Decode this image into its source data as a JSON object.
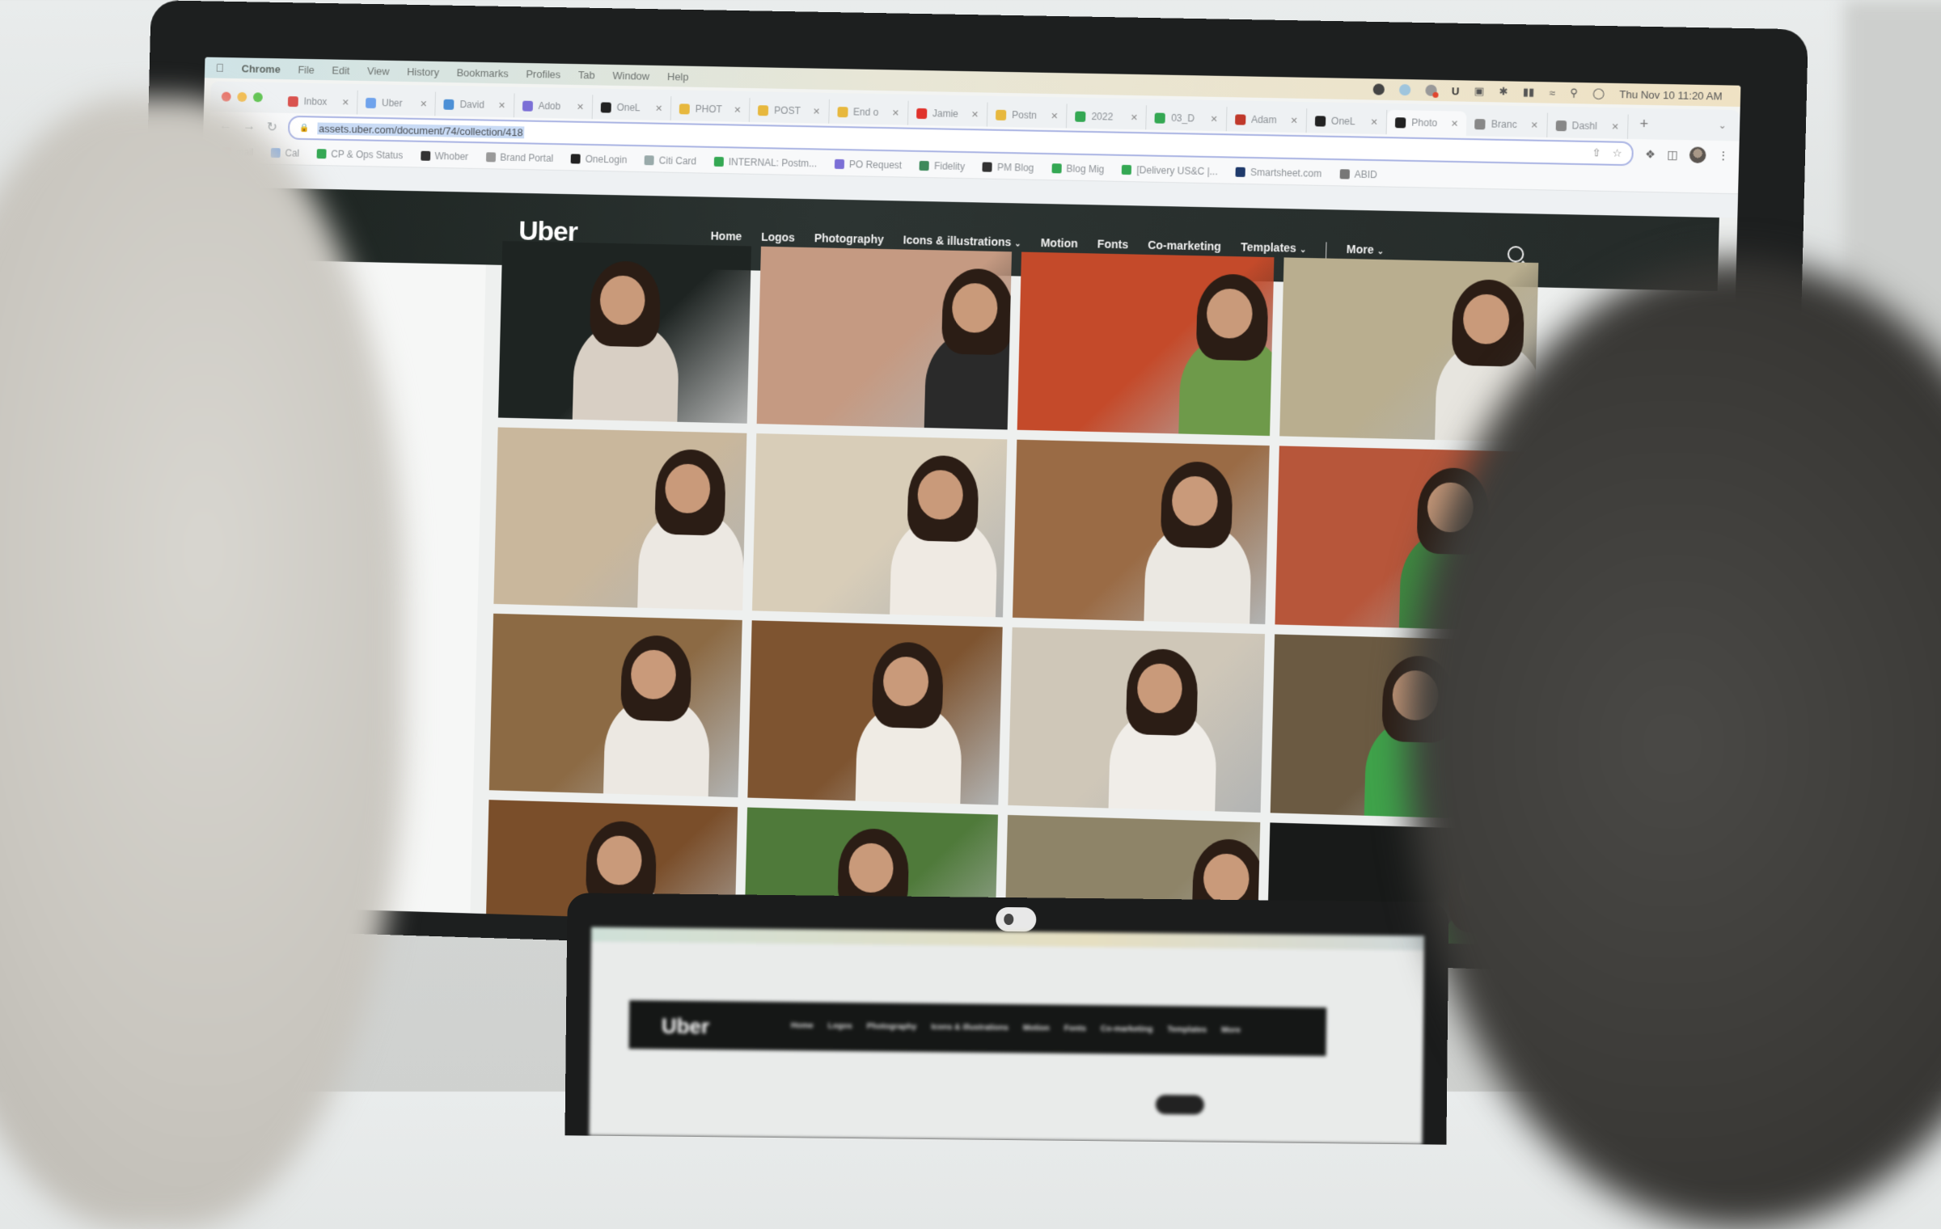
{
  "menubar": {
    "app_name": "Chrome",
    "items": [
      "File",
      "Edit",
      "View",
      "History",
      "Bookmarks",
      "Profiles",
      "Tab",
      "Window",
      "Help"
    ],
    "tray_icons": [
      "notion-icon",
      "globe-icon",
      "screen-record-icon",
      "u-icon",
      "window-icon",
      "bluetooth-icon",
      "battery-icon",
      "wifi-icon",
      "spotlight-search-icon",
      "control-center-icon"
    ],
    "clock": "Thu Nov 10  11:20 AM"
  },
  "tabs": [
    {
      "label": "Inbox",
      "icon": "gmail-icon",
      "color": "#d9534f"
    },
    {
      "label": "Uber",
      "icon": "calendar-icon",
      "color": "#6fa3ec"
    },
    {
      "label": "David",
      "icon": "k-icon",
      "color": "#4c90d6"
    },
    {
      "label": "Adob",
      "icon": "form-icon",
      "color": "#7b6fd6"
    },
    {
      "label": "OneL",
      "icon": "onelogin-icon",
      "color": "#222222"
    },
    {
      "label": "PHOT",
      "icon": "slides-icon",
      "color": "#e7b83e"
    },
    {
      "label": "POST",
      "icon": "slides-icon",
      "color": "#e7b83e"
    },
    {
      "label": "End o",
      "icon": "slides-icon",
      "color": "#e7b83e"
    },
    {
      "label": "Jamie",
      "icon": "youtube-icon",
      "color": "#e0322b"
    },
    {
      "label": "Postn",
      "icon": "slides-icon",
      "color": "#e7b83e"
    },
    {
      "label": "2022",
      "icon": "drive-icon",
      "color": "#34a853"
    },
    {
      "label": "03_D",
      "icon": "drive-icon",
      "color": "#34a853"
    },
    {
      "label": "Adam",
      "icon": "chrome-profile-icon",
      "color": "#c0392b"
    },
    {
      "label": "OneL",
      "icon": "onelogin-icon",
      "color": "#222222"
    },
    {
      "label": "Photo",
      "icon": "arrow-box-icon",
      "color": "#222222",
      "active": true
    },
    {
      "label": "Branc",
      "icon": "brand-icon",
      "color": "#888888"
    },
    {
      "label": "Dashl",
      "icon": "brand-icon",
      "color": "#888888"
    }
  ],
  "toolbar": {
    "url": "assets.uber.com/document/74/collection/418",
    "new_tab": "+",
    "tab_menu": "⌄"
  },
  "bookmarks": [
    {
      "label": "mail",
      "color": "#d9534f"
    },
    {
      "label": "Cal",
      "color": "#6fa3ec"
    },
    {
      "label": "CP & Ops Status",
      "color": "#34a853"
    },
    {
      "label": "Whober",
      "color": "#333333"
    },
    {
      "label": "Brand Portal",
      "color": "#999999"
    },
    {
      "label": "OneLogin",
      "color": "#222222"
    },
    {
      "label": "Citi Card",
      "color": "#9aa"
    },
    {
      "label": "INTERNAL: Postm...",
      "color": "#34a853"
    },
    {
      "label": "PO Request",
      "color": "#7b6fd6"
    },
    {
      "label": "Fidelity",
      "color": "#3d8a5a"
    },
    {
      "label": "PM Blog",
      "color": "#333333"
    },
    {
      "label": "Blog Mig",
      "color": "#34a853"
    },
    {
      "label": "[Delivery US&C |...",
      "color": "#34a853"
    },
    {
      "label": "Smartsheet.com",
      "color": "#1f3a6b"
    },
    {
      "label": "ABID",
      "color": "#777777"
    }
  ],
  "site": {
    "logo": "Uber",
    "nav": [
      {
        "label": "Home",
        "dropdown": false
      },
      {
        "label": "Logos",
        "dropdown": false
      },
      {
        "label": "Photography",
        "dropdown": false
      },
      {
        "label": "Icons & illustrations",
        "dropdown": true
      },
      {
        "label": "Motion",
        "dropdown": false
      },
      {
        "label": "Fonts",
        "dropdown": false
      },
      {
        "label": "Co-marketing",
        "dropdown": false
      },
      {
        "label": "Templates",
        "dropdown": true
      },
      {
        "label": "More",
        "dropdown": true
      }
    ],
    "chevron": "⌄"
  },
  "photos": [
    {
      "desc": "mother holding baby, dark background",
      "bg": "#1e2422",
      "accent": "#d8cfc4"
    },
    {
      "desc": "courier with green backpack smiling",
      "bg": "#c59a82",
      "accent": "#2a2a2a"
    },
    {
      "desc": "shop owner with Uber Eats bag",
      "bg": "#c44a2a",
      "accent": "#6e9a4a"
    },
    {
      "desc": "woman at counter with plants",
      "bg": "#b9ae8f",
      "accent": "#e7e5df"
    },
    {
      "desc": "woman at bakery display",
      "bg": "#c9b79c",
      "accent": "#ece8e2"
    },
    {
      "desc": "two women at pastry counter",
      "bg": "#d8cdb8",
      "accent": "#efeae3"
    },
    {
      "desc": "smiling woman portrait in shop",
      "bg": "#9a6b45",
      "accent": "#ebe8e2"
    },
    {
      "desc": "shopkeeper handing bag to courier",
      "bg": "#b7563a",
      "accent": "#3e8a40"
    },
    {
      "desc": "woman at checkout counter",
      "bg": "#8c6a44",
      "accent": "#ece8e2"
    },
    {
      "desc": "two women in grocery aisle",
      "bg": "#7e5430",
      "accent": "#efebe4"
    },
    {
      "desc": "woman handing order over counter",
      "bg": "#cfc7b8",
      "accent": "#f0ede8"
    },
    {
      "desc": "courier with green bag receiving order",
      "bg": "#6b5a42",
      "accent": "#3fa34a"
    },
    {
      "desc": "mother and child in shop",
      "bg": "#7a4e2a",
      "accent": "#ebe5dc"
    },
    {
      "desc": "green Uber Eats bags on counter",
      "bg": "#4f7a3a",
      "accent": "#1f1f1f"
    },
    {
      "desc": "man and woman at shop counter",
      "bg": "#8e8468",
      "accent": "#e8e4dd"
    },
    {
      "desc": "dark photo of courier",
      "bg": "#181a19",
      "accent": "#3b7a3a"
    }
  ],
  "laptop": {
    "logo": "Uber",
    "nav": [
      "Home",
      "Logos",
      "Photography",
      "Icons & illustrations",
      "Motion",
      "Fonts",
      "Co-marketing",
      "Templates",
      "More"
    ]
  }
}
